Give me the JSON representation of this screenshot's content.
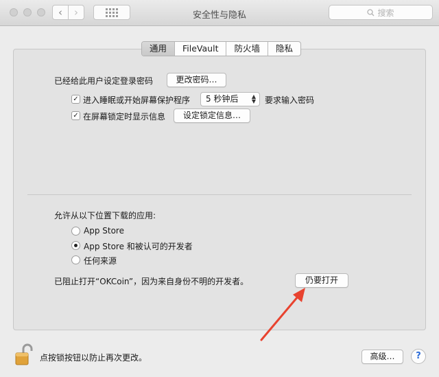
{
  "window": {
    "title": "安全性与隐私",
    "search_placeholder": "搜索"
  },
  "tabs": [
    "通用",
    "FileVault",
    "防火墙",
    "隐私"
  ],
  "general": {
    "password_label": "已经给此用户设定登录密码",
    "change_password_button": "更改密码…",
    "require_password_check": "✓",
    "require_password_label": "进入睡眠或开始屏幕保护程序",
    "delay_select_value": "5 秒钟后",
    "require_password_suffix": "要求输入密码",
    "show_message_check": "✓",
    "show_message_label": "在屏幕锁定时显示信息",
    "set_lock_message_button": "设定锁定信息…"
  },
  "downloads": {
    "heading": "允许从以下位置下载的应用:",
    "options": [
      "App Store",
      "App Store 和被认可的开发者",
      "任何来源"
    ],
    "selected_index": 1,
    "blocked_message": "已阻止打开“OKCoin”，因为来自身份不明的开发者。",
    "open_anyway_button": "仍要打开"
  },
  "footer": {
    "lock_text": "点按锁按钮以防止再次更改。",
    "advanced_button": "高级…",
    "help_label": "?"
  },
  "colors": {
    "annotation_arrow": "#e8432f",
    "lock_body": "#e0a23a"
  },
  "icons": [
    "back-icon",
    "forward-icon",
    "grid-icon",
    "search-icon",
    "padlock-open-icon",
    "help-icon"
  ]
}
